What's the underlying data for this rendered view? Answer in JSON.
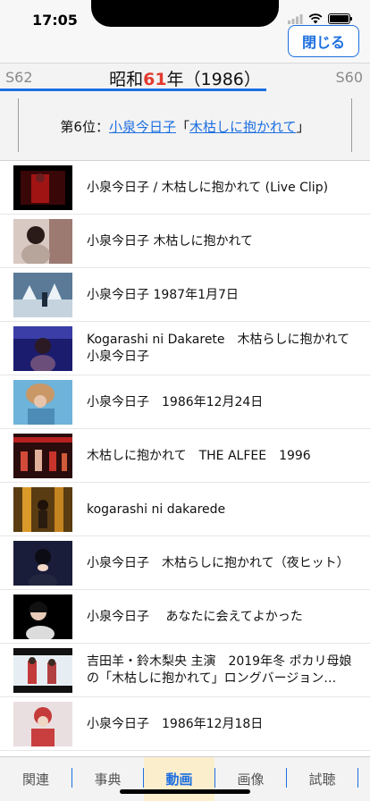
{
  "status_bar": {
    "time": "17:05",
    "icons": [
      "signal-icon",
      "wifi-icon",
      "battery-icon"
    ],
    "battery_level": 1.0
  },
  "header": {
    "close_label": "閉じる"
  },
  "year_bar": {
    "prev": "S62",
    "next": "S60",
    "title_prefix": "昭和",
    "title_num": "61",
    "title_suffix": "年（1986）",
    "progress": 0.72
  },
  "rank": {
    "prefix": "第6位：",
    "artist": "小泉今日子",
    "open_quote": "「",
    "song": "木枯しに抱かれて",
    "close_quote": "」"
  },
  "videos": [
    {
      "title": "小泉今日子 / 木枯しに抱かれて (Live Clip)"
    },
    {
      "title": "小泉今日子 木枯しに抱かれて"
    },
    {
      "title": "小泉今日子 1987年1月7日"
    },
    {
      "title": "Kogarashi ni Dakarete　木枯らしに抱かれて　小泉今日子"
    },
    {
      "title": "小泉今日子　1986年12月24日"
    },
    {
      "title": "木枯しに抱かれて　THE ALFEE　1996"
    },
    {
      "title": "kogarashi ni dakarede"
    },
    {
      "title": "小泉今日子　木枯らしに抱かれて（夜ヒット）"
    },
    {
      "title": "小泉今日子　 あなたに会えてよかった"
    },
    {
      "title": "吉田羊・鈴木梨央 主演　2019年冬 ポカリ母娘の「木枯しに抱かれて」ロングバージョン…"
    },
    {
      "title": "小泉今日子　1986年12月18日"
    }
  ],
  "tabs": [
    {
      "label": "関連",
      "active": false
    },
    {
      "label": "事典",
      "active": false
    },
    {
      "label": "動画",
      "active": true
    },
    {
      "label": "画像",
      "active": false
    },
    {
      "label": "試聴",
      "active": false
    }
  ],
  "colors": {
    "accent": "#1d6fe0",
    "year_number": "#e23a2e",
    "active_tab_bg": "#fbeecd"
  }
}
